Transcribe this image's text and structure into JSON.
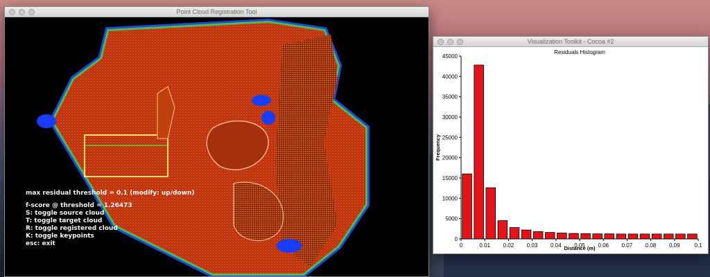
{
  "desktop": {
    "background": "mountain-wallpaper"
  },
  "pcr_window": {
    "title": "Point Cloud Registration Tool",
    "hud": {
      "threshold": "max residual threshold = 0.1 (modify: up/down)",
      "fscore": "f-score @ threshold = 1.26473",
      "k1": "S: toggle source cloud",
      "k2": "T: toggle target cloud",
      "k3": "R: toggle registered cloud",
      "k4": "K: toggle keypoints",
      "k5": "esc: exit"
    }
  },
  "vtk_window": {
    "title": "Visualization Toolkit - Cocoa #2",
    "chart_data": {
      "type": "bar",
      "title": "Residuals Histogram",
      "xlabel": "Distance (m)",
      "ylabel": "Frequency",
      "xlim": [
        0,
        0.1
      ],
      "ylim": [
        0,
        45000
      ],
      "xticks": [
        "0",
        "0.01",
        "0.02",
        "0.03",
        "0.04",
        "0.05",
        "0.06",
        "0.07",
        "0.08",
        "0.09",
        "0.1"
      ],
      "yticks": [
        "0",
        "5000",
        "10000",
        "15000",
        "20000",
        "25000",
        "30000",
        "35000",
        "40000",
        "45000"
      ],
      "bin_width": 0.005,
      "bins": [
        0.0025,
        0.0075,
        0.0125,
        0.0175,
        0.0225,
        0.0275,
        0.0325,
        0.0375,
        0.0425,
        0.0475,
        0.0525,
        0.0575,
        0.0625,
        0.0675,
        0.0725,
        0.0775,
        0.0825,
        0.0875,
        0.0925,
        0.0975
      ],
      "values": [
        16000,
        42800,
        12600,
        4500,
        2800,
        2200,
        1800,
        1600,
        1450,
        1350,
        1300,
        1250,
        1250,
        1200,
        1200,
        1200,
        1200,
        1200,
        1200,
        1200
      ],
      "bar_color": "#e0141a"
    }
  }
}
